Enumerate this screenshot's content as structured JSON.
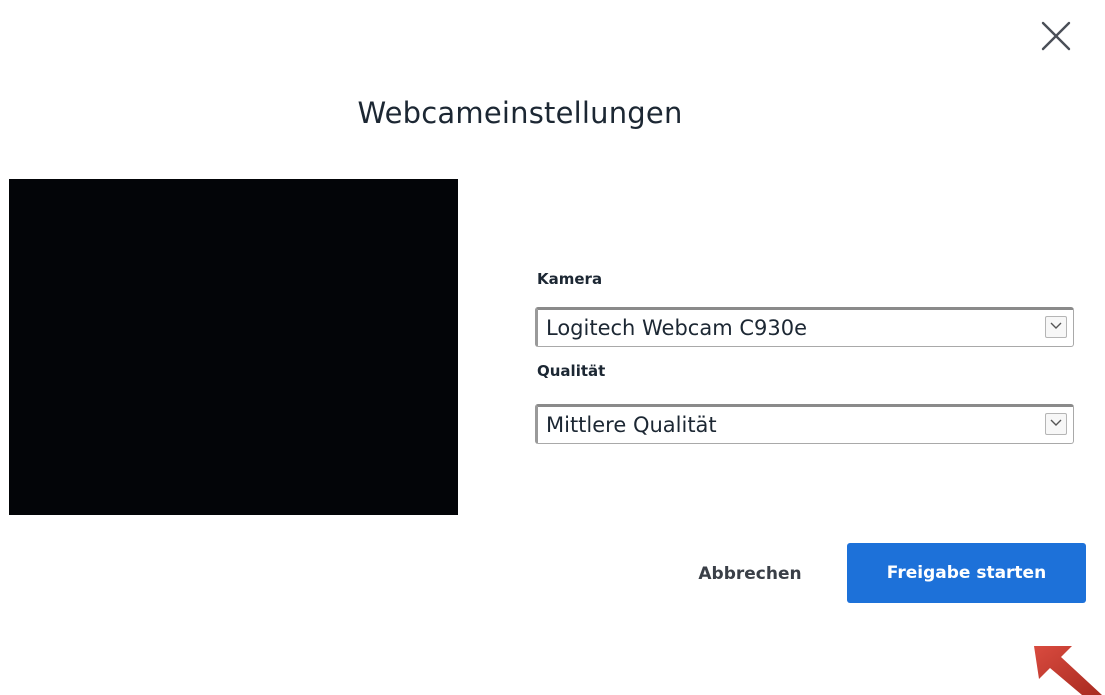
{
  "dialog": {
    "title": "Webcameinstellungen",
    "close_icon": "close-icon"
  },
  "preview": {
    "background": "#030508"
  },
  "camera": {
    "label": "Kamera",
    "selected": "Logitech Webcam C930e"
  },
  "quality": {
    "label": "Qualität",
    "selected": "Mittlere Qualität"
  },
  "actions": {
    "cancel_label": "Abbrechen",
    "start_label": "Freigabe starten",
    "accent_color": "#1d71d9"
  },
  "annotation": {
    "icon": "pointer-arrow-icon",
    "color": "#c0392b"
  }
}
